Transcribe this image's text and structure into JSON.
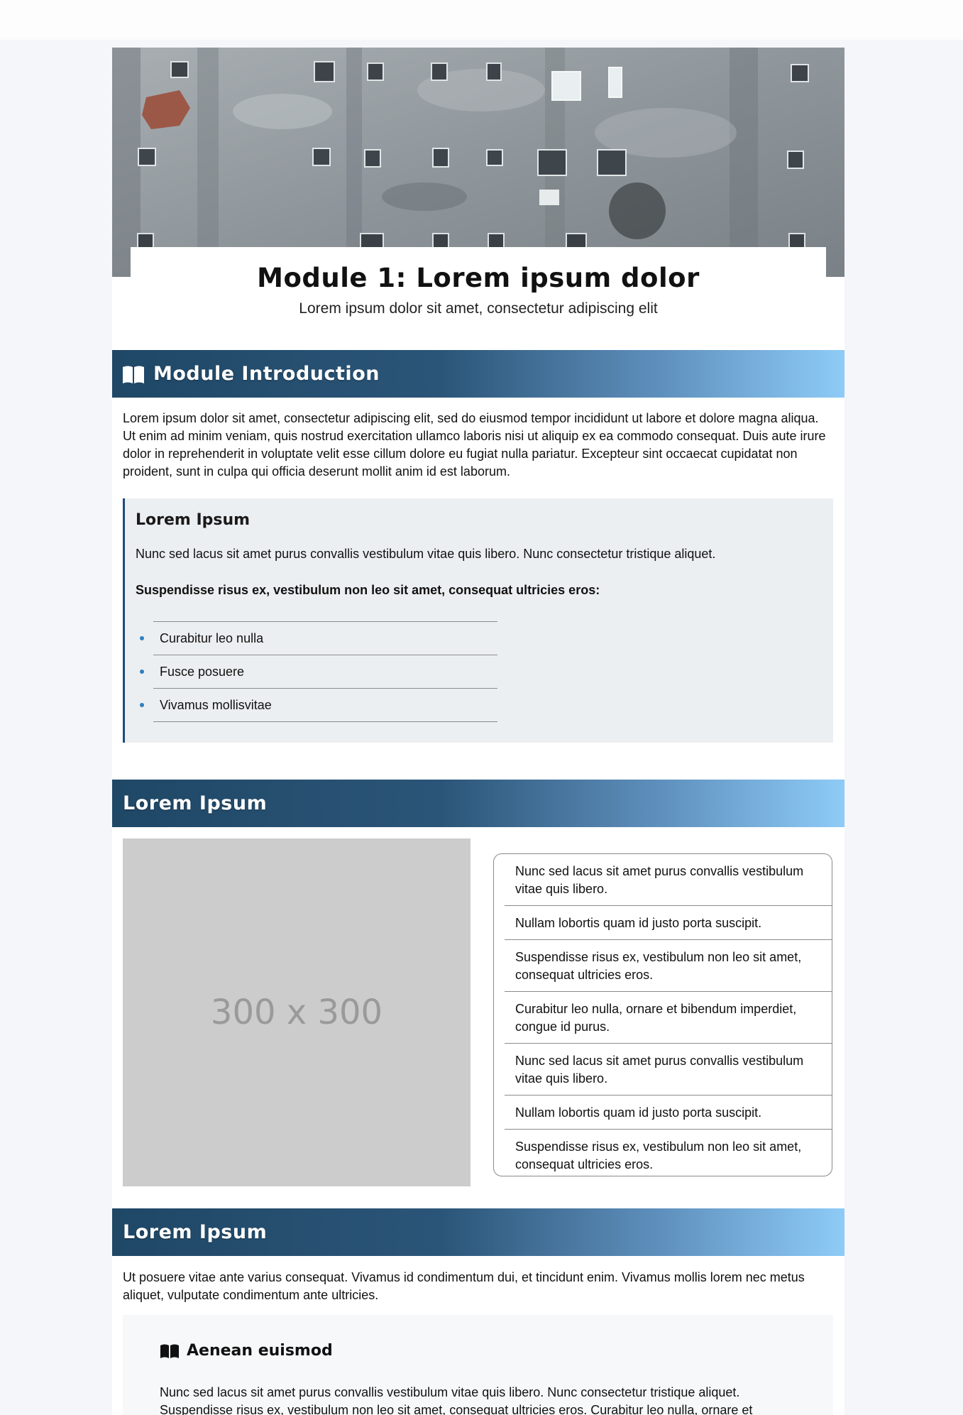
{
  "header": {
    "title": "Module 1: Lorem ipsum dolor",
    "subtitle": "Lorem ipsum dolor sit amet, consectetur adipiscing elit"
  },
  "intro": {
    "heading": "Module Introduction",
    "icon": "book-open-icon",
    "paragraph": "Lorem ipsum dolor sit amet, consectetur adipiscing elit, sed do eiusmod tempor incididunt ut labore et dolore magna aliqua. Ut enim ad minim veniam, quis nostrud exercitation ullamco laboris nisi ut aliquip ex ea commodo consequat. Duis aute irure dolor in reprehenderit in voluptate velit esse cillum dolore eu fugiat nulla pariatur. Excepteur sint occaecat cupidatat non proident, sunt in culpa qui officia deserunt mollit anim id est laborum.",
    "callout": {
      "title": "Lorem Ipsum",
      "text": "Nunc sed lacus sit amet purus convallis vestibulum vitae quis libero. Nunc consectetur tristique aliquet.",
      "bold_text": "Suspendisse risus ex, vestibulum non leo sit amet, consequat ultricies eros:",
      "bullets": [
        "Curabitur leo nulla",
        "Fusce posuere",
        "Vivamus mollisvitae"
      ]
    }
  },
  "section2": {
    "heading": "Lorem Ipsum",
    "placeholder": "300 x 300",
    "items": [
      "Nunc sed lacus sit amet purus convallis vestibulum vitae quis libero.",
      "Nullam lobortis quam id justo porta suscipit.",
      "Suspendisse risus ex, vestibulum non leo sit amet, consequat ultricies eros.",
      "Curabitur leo nulla, ornare et bibendum imperdiet, congue id purus.",
      "Nunc sed lacus sit amet purus convallis vestibulum vitae quis libero.",
      "Nullam lobortis quam id justo porta suscipit.",
      "Suspendisse risus ex, vestibulum non leo sit amet, consequat ultricies eros."
    ]
  },
  "section3": {
    "heading": "Lorem Ipsum",
    "paragraph": "Ut posuere vitae ante varius consequat. Vivamus id condimentum dui, et tincidunt enim. Vivamus mollis lorem nec metus aliquet, vulputate condimentum ante ultricies.",
    "card": {
      "icon": "book-open-icon",
      "title": "Aenean euismod",
      "text": "Nunc sed lacus sit amet purus convallis vestibulum vitae quis libero. Nunc consectetur tristique aliquet. Suspendisse risus ex, vestibulum non leo sit amet, consequat ultricies eros. Curabitur leo nulla, ornare et"
    }
  },
  "colors": {
    "banner_start": "#1f4766",
    "banner_end": "#8ecbf7",
    "callout_border": "#1f4a78",
    "bullet": "#2f7fbf"
  }
}
